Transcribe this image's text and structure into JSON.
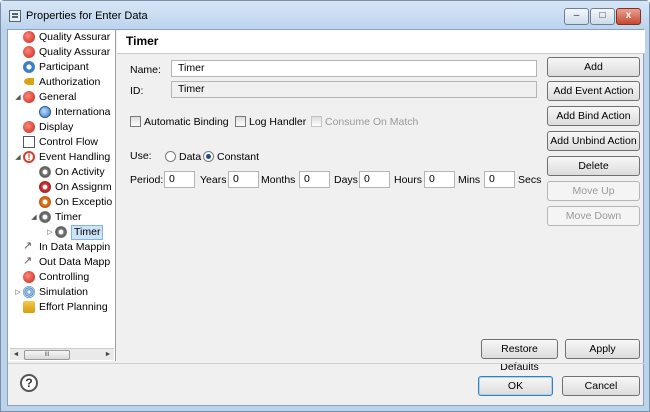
{
  "window": {
    "title": "Properties for Enter Data",
    "min_label": "–",
    "max_label": "□",
    "close_label": "x"
  },
  "tree": {
    "items": [
      {
        "label": "Quality Assurar",
        "twisty": ""
      },
      {
        "label": "Quality Assurar",
        "twisty": ""
      },
      {
        "label": "Participant",
        "twisty": ""
      },
      {
        "label": "Authorization",
        "twisty": ""
      },
      {
        "label": "General",
        "twisty": "◢"
      },
      {
        "label": "Internationa",
        "twisty": ""
      },
      {
        "label": "Display",
        "twisty": ""
      },
      {
        "label": "Control Flow",
        "twisty": ""
      },
      {
        "label": "Event Handling",
        "twisty": "◢"
      },
      {
        "label": "On Activity",
        "twisty": ""
      },
      {
        "label": "On Assignm",
        "twisty": ""
      },
      {
        "label": "On Exceptio",
        "twisty": ""
      },
      {
        "label": "Timer",
        "twisty": "◢"
      },
      {
        "label": "Timer",
        "twisty": "▷"
      },
      {
        "label": "In Data Mappin",
        "twisty": ""
      },
      {
        "label": "Out Data Mapp",
        "twisty": ""
      },
      {
        "label": "Controlling",
        "twisty": ""
      },
      {
        "label": "Simulation",
        "twisty": "▷"
      },
      {
        "label": "Effort Planning",
        "twisty": ""
      }
    ],
    "scroll_left": "◄",
    "scroll_right": "►",
    "scroll_thumb": "III"
  },
  "panel": {
    "heading": "Timer",
    "name_label": "Name:",
    "name_value": "Timer",
    "id_label": "ID:",
    "id_value": "Timer",
    "checkboxes": {
      "automatic_binding": "Automatic Binding",
      "log_handler": "Log Handler",
      "consume_on_match": "Consume On Match"
    },
    "use_label": "Use:",
    "use_options": {
      "data": "Data",
      "constant": "Constant"
    },
    "period_label": "Period:",
    "period": [
      {
        "value": "0",
        "unit": "Years"
      },
      {
        "value": "0",
        "unit": "Months"
      },
      {
        "value": "0",
        "unit": "Days"
      },
      {
        "value": "0",
        "unit": "Hours"
      },
      {
        "value": "0",
        "unit": "Mins"
      },
      {
        "value": "0",
        "unit": "Secs"
      }
    ]
  },
  "side_buttons": {
    "add": "Add",
    "add_event_action": "Add Event Action",
    "add_bind_action": "Add Bind Action",
    "add_unbind_action": "Add Unbind Action",
    "delete": "Delete",
    "move_up": "Move Up",
    "move_down": "Move Down"
  },
  "bottom": {
    "restore_defaults": "Restore Defaults",
    "apply": "Apply",
    "ok": "OK",
    "cancel": "Cancel",
    "help": "?"
  }
}
